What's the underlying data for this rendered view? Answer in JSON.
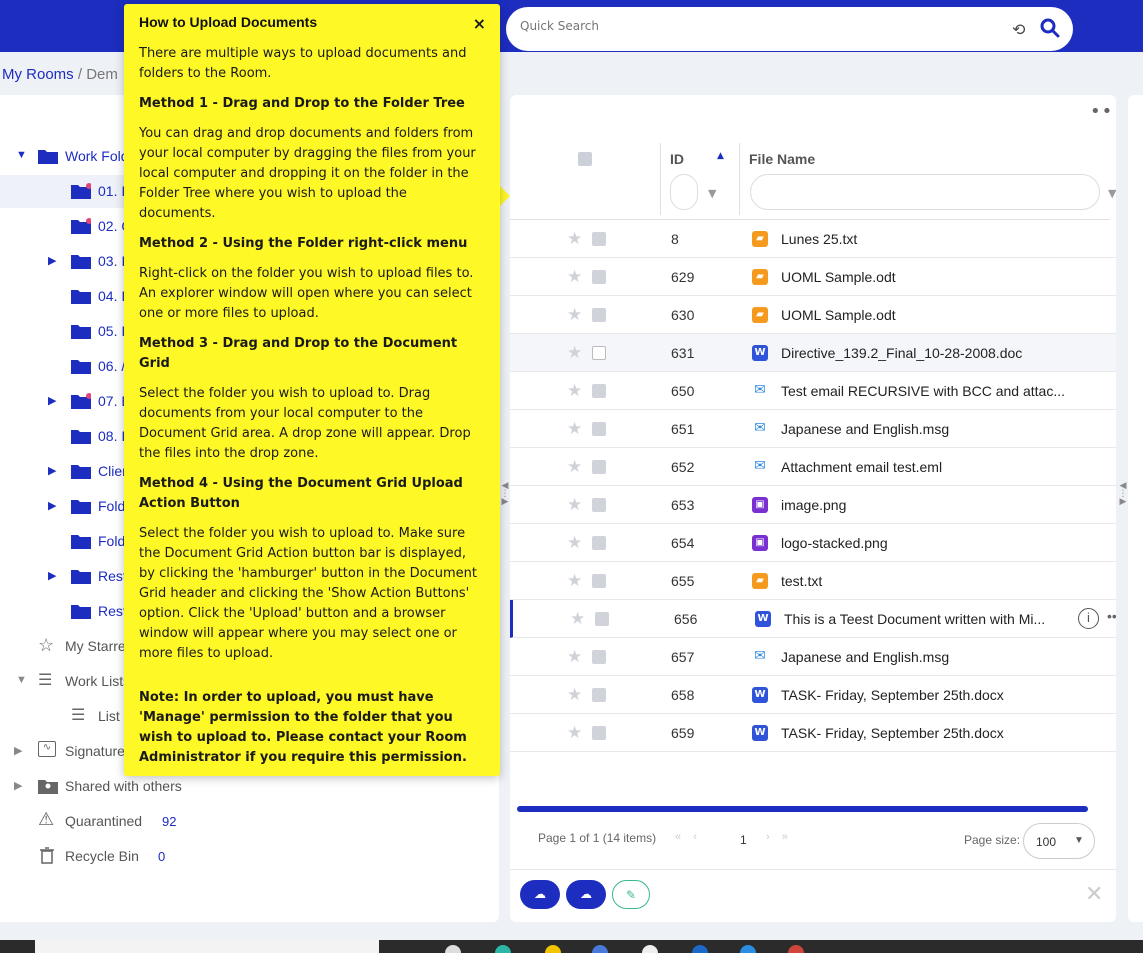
{
  "header": {
    "search_placeholder": "Quick Search",
    "history_icon": "history-icon",
    "search_icon": "search-icon",
    "color": "#1c2dbf"
  },
  "breadcrumb": {
    "root": "My Rooms",
    "separator": " / ",
    "current_partial": "Dem"
  },
  "tree": {
    "work_folders": "Work Fold",
    "subfolders": [
      {
        "label": "01. I"
      },
      {
        "label": "02. C"
      },
      {
        "label": "03. I"
      },
      {
        "label": "04. I"
      },
      {
        "label": "05. I"
      },
      {
        "label": "06. /"
      },
      {
        "label": "07. E"
      },
      {
        "label": "08. I"
      },
      {
        "label": "Clien"
      },
      {
        "label": "Folde"
      },
      {
        "label": "Folde"
      },
      {
        "label": "Restr"
      },
      {
        "label": "Restr"
      }
    ],
    "my_starred": "My Starre",
    "work_lists": "Work Lists",
    "list_item": "List",
    "signature": "Signature",
    "shared_with_others": "Shared with others",
    "quarantined": "Quarantined",
    "quarantined_count": "92",
    "recycle_bin": "Recycle Bin",
    "recycle_count": "0"
  },
  "grid": {
    "more_label": "•••",
    "col_id": "ID",
    "col_name": "File Name",
    "rows": [
      {
        "id": "8",
        "name": "Lunes 25.txt",
        "type": "txt"
      },
      {
        "id": "629",
        "name": "UOML Sample.odt",
        "type": "txt"
      },
      {
        "id": "630",
        "name": "UOML Sample.odt",
        "type": "txt"
      },
      {
        "id": "631",
        "name": "Directive_139.2_Final_10-28-2008.doc",
        "type": "doc"
      },
      {
        "id": "650",
        "name": "Test email RECURSIVE with BCC and attac...",
        "type": "mail"
      },
      {
        "id": "651",
        "name": "Japanese and English.msg",
        "type": "mail"
      },
      {
        "id": "652",
        "name": "Attachment email test.eml",
        "type": "mail"
      },
      {
        "id": "653",
        "name": "image.png",
        "type": "img"
      },
      {
        "id": "654",
        "name": "logo-stacked.png",
        "type": "img"
      },
      {
        "id": "655",
        "name": "test.txt",
        "type": "txt"
      },
      {
        "id": "656",
        "name": "This is a Teest Document written with Mi...",
        "type": "doc"
      },
      {
        "id": "657",
        "name": "Japanese and English.msg",
        "type": "mail"
      },
      {
        "id": "658",
        "name": "TASK- Friday, September 25th.docx",
        "type": "doc"
      },
      {
        "id": "659",
        "name": "TASK- Friday, September 25th.docx",
        "type": "doc"
      }
    ],
    "pager_info": "Page 1 of 1 (14 items)",
    "page_current": "1",
    "page_size_label": "Page size:",
    "page_size_value": "100"
  },
  "tooltip": {
    "title": "How to Upload Documents",
    "close": "×",
    "intro": "There are multiple ways to upload documents and folders to the Room.",
    "m1_title": "Method 1 - Drag and Drop to the Folder Tree",
    "m1_body": "You can drag and drop documents and folders from your local computer by dragging the files from your local computer and dropping it on the folder in the Folder Tree where you wish to upload the documents.",
    "m2_title": "Method 2 - Using the Folder right-click menu",
    "m2_body": "Right-click on the folder you wish to upload files to. An explorer window will open where you can select one or more files to upload.",
    "m3_title": "Method 3 - Drag and Drop to the Document Grid",
    "m3_body": "Select the folder you wish to upload to. Drag documents from your local computer to the Document Grid area. A drop zone will appear. Drop the files into the drop zone.",
    "m4_title": "Method 4 - Using the Document Grid Upload Action Button",
    "m4_body": "Select the folder you wish to upload to. Make sure the Document Grid Action button bar is displayed, by clicking the 'hamburger' button in the Document Grid header and clicking the 'Show Action Buttons' option. Click the 'Upload' button and a browser window will appear where you may select one or more files to upload.",
    "note": "Note: In order to upload, you must have 'Manage' permission to the folder that you wish to upload to. Please contact your Room Administrator if you require this permission.",
    "bg_color": "#fff827"
  }
}
